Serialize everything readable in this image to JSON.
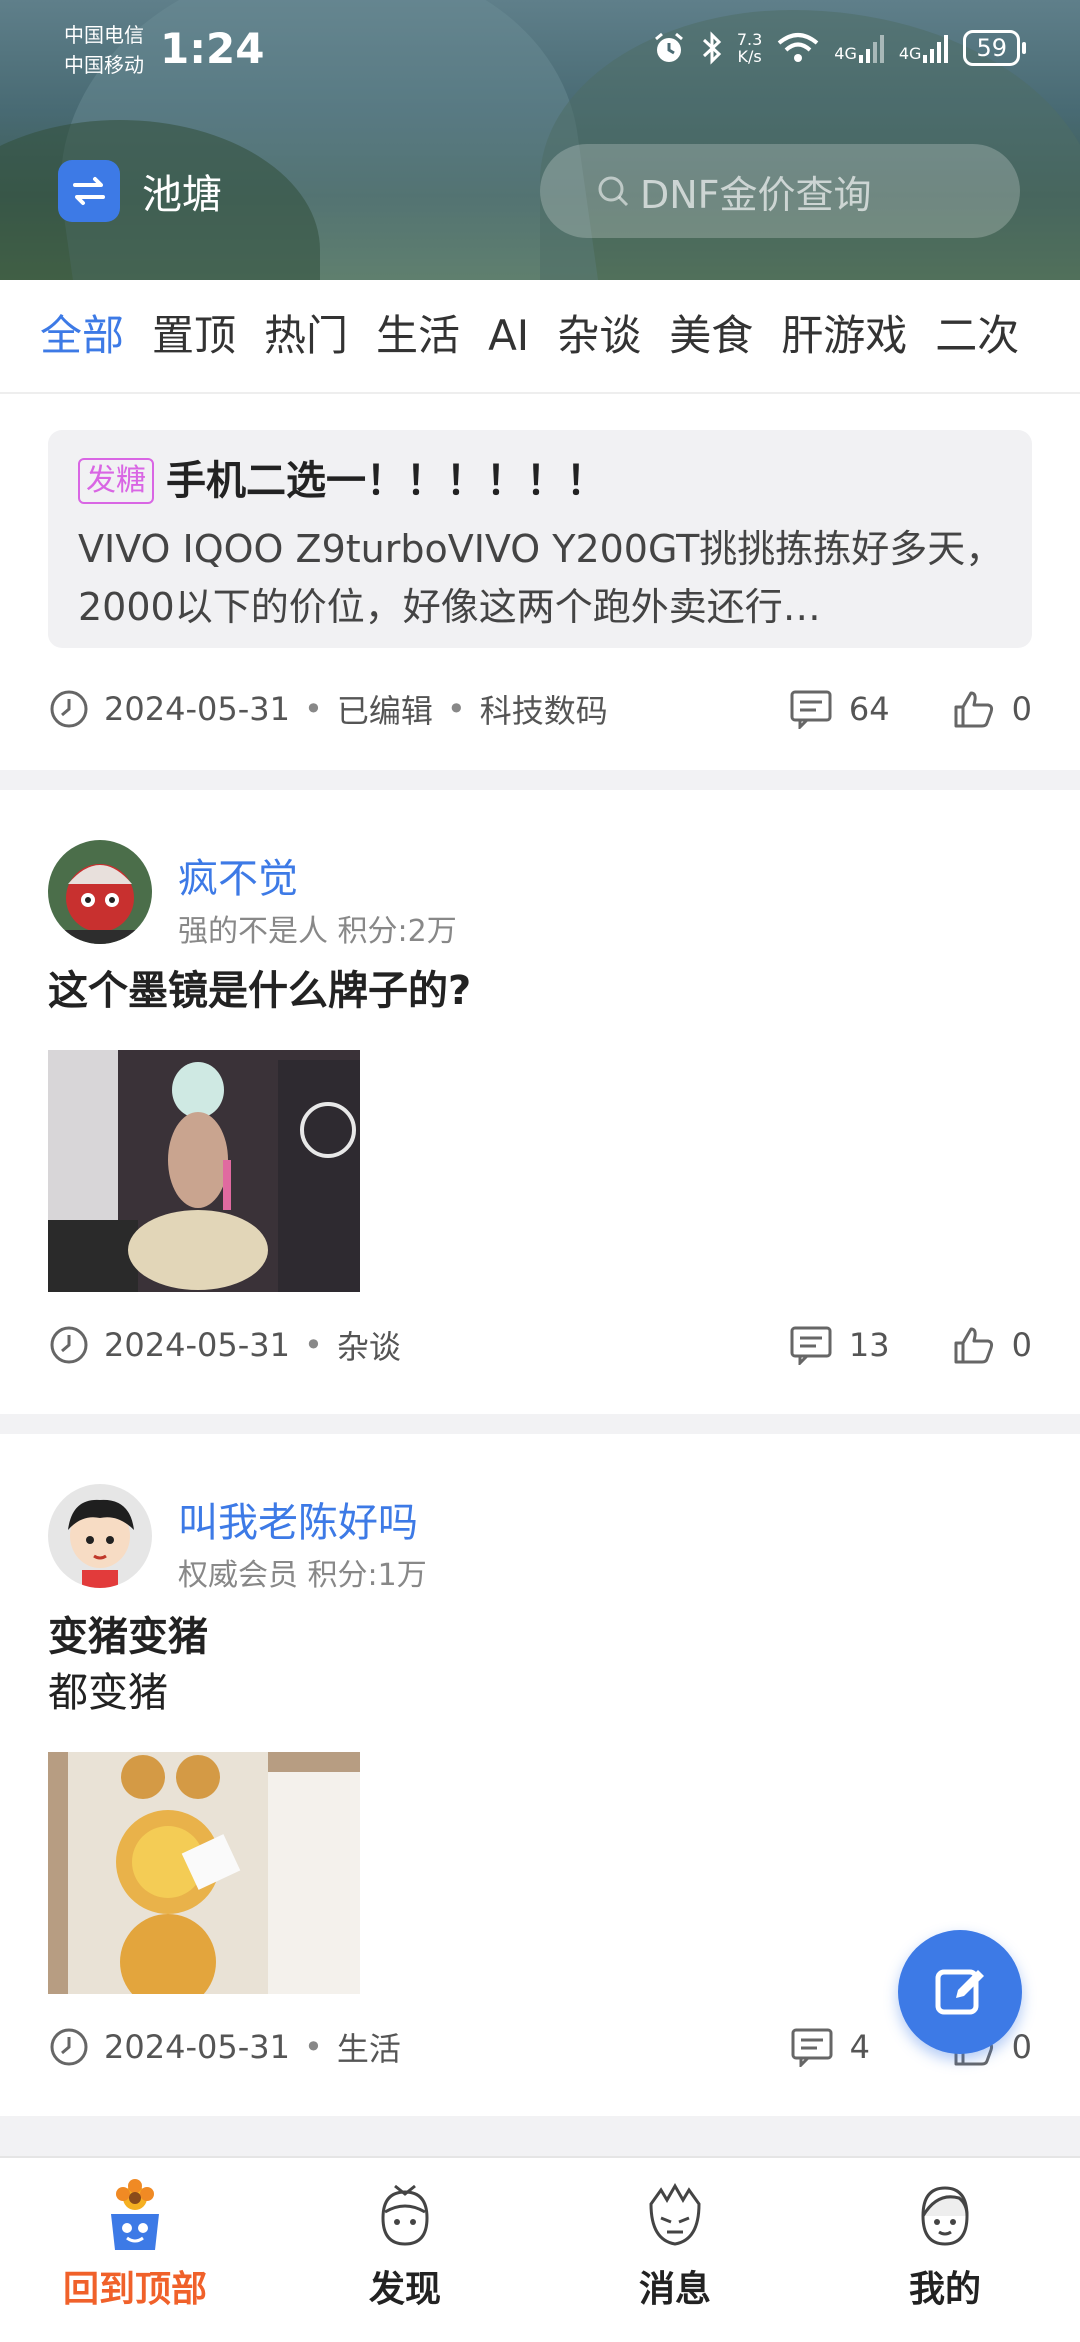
{
  "status_bar": {
    "carrier1": "中国电信",
    "carrier2": "中国移动",
    "time": "1:24",
    "speed_value": "7.3",
    "speed_unit": "K/s",
    "net1": "4G",
    "net2": "4G",
    "battery": "59"
  },
  "header": {
    "app_name": "池塘",
    "search_placeholder": "DNF金价查询"
  },
  "tabs": [
    {
      "label": "全部",
      "active": true
    },
    {
      "label": "置顶",
      "active": false
    },
    {
      "label": "热门",
      "active": false
    },
    {
      "label": "生活",
      "active": false
    },
    {
      "label": "AI",
      "active": false
    },
    {
      "label": "杂谈",
      "active": false
    },
    {
      "label": "美食",
      "active": false
    },
    {
      "label": "肝游戏",
      "active": false
    },
    {
      "label": "二次",
      "active": false
    }
  ],
  "posts": [
    {
      "tag": "发糖",
      "title": "手机二选一！！！！！！",
      "body": " VIVO IQOO Z9turboVIVO Y200GT挑挑拣拣好多天，2000以下的价位，好像这两个跑外卖还行…",
      "date": "2024-05-31",
      "edited": "已编辑",
      "category": "科技数码",
      "comments": "64",
      "likes": "0"
    },
    {
      "username": "疯不觉",
      "user_title": "强的不是人",
      "points": "积分:2万",
      "title": "这个墨镜是什么牌子的?",
      "date": "2024-05-31",
      "category": "杂谈",
      "comments": "13",
      "likes": "0"
    },
    {
      "username": "叫我老陈好吗",
      "user_title": "权威会员",
      "points": "积分:1万",
      "title": "变猪变猪",
      "body": "都变猪",
      "date": "2024-05-31",
      "category": "生活",
      "comments": "4",
      "likes": "0"
    }
  ],
  "bottom_nav": [
    {
      "label": "回到顶部",
      "icon": "flower-character-icon",
      "active": true
    },
    {
      "label": "发现",
      "icon": "character-discover-icon",
      "active": false
    },
    {
      "label": "消息",
      "icon": "character-message-icon",
      "active": false
    },
    {
      "label": "我的",
      "icon": "character-profile-icon",
      "active": false
    }
  ],
  "colors": {
    "accent": "#3d7ae6",
    "active_nav": "#f0612a",
    "tag": "#d966e4"
  }
}
